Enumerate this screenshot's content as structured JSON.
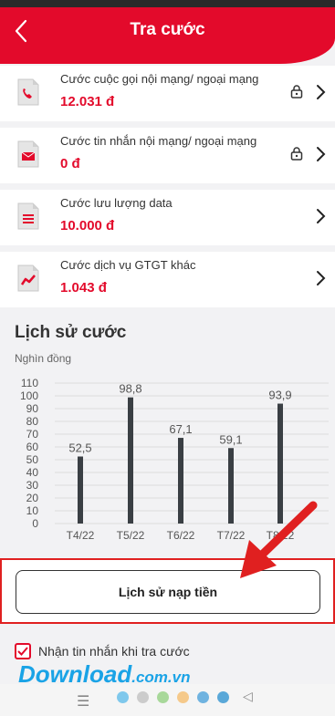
{
  "header": {
    "title": "Tra cước"
  },
  "charges": [
    {
      "name": "Cước cuộc gọi nội mạng/ ngoại mạng",
      "amount": "12.031 đ",
      "icon": "phone-icon",
      "locked": true
    },
    {
      "name": "Cước tin nhắn nội mạng/ ngoại mạng",
      "amount": "0 đ",
      "icon": "envelope-icon",
      "locked": true
    },
    {
      "name": "Cước lưu lượng data",
      "amount": "10.000 đ",
      "icon": "list-icon",
      "locked": false
    },
    {
      "name": "Cước dịch vụ GTGT khác",
      "amount": "1.043 đ",
      "icon": "trend-icon",
      "locked": false
    }
  ],
  "history": {
    "title": "Lịch sử cước",
    "unit": "Nghìn đồng"
  },
  "chart_data": {
    "type": "bar",
    "categories": [
      "T4/22",
      "T5/22",
      "T6/22",
      "T7/22",
      "T8/22"
    ],
    "values": [
      52.5,
      98.8,
      67.1,
      59.1,
      93.9
    ],
    "value_labels": [
      "52,5",
      "98,8",
      "67,1",
      "59,1",
      "93,9"
    ],
    "ylabel": "Nghìn đồng",
    "ylim": [
      0,
      110
    ],
    "yticks": [
      0,
      10,
      20,
      30,
      40,
      50,
      60,
      70,
      80,
      90,
      100,
      110
    ],
    "grid": true,
    "bar_color": "#3a3f44"
  },
  "topup_button": {
    "label": "Lịch sử nạp tiền"
  },
  "sms_option": {
    "label": "Nhận tin nhắn khi tra cước",
    "checked": true
  },
  "watermark": {
    "text": "Download",
    "tld": ".com.vn"
  },
  "colors": {
    "brand": "#e30a2b",
    "highlight": "#e02020"
  },
  "navbar": {
    "menu": "☰",
    "back": "◁",
    "dots": [
      "#7fc8ec",
      "#cccccc",
      "#a8d89a",
      "#f5c98a",
      "#6fb3e0",
      "#5aa8d8"
    ]
  }
}
